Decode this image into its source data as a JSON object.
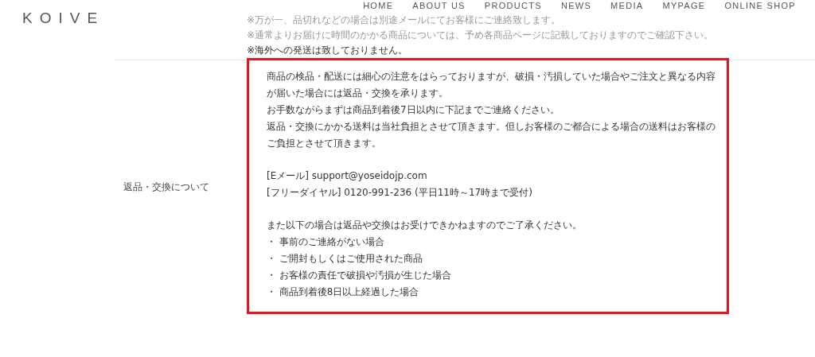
{
  "logo": "KOIVE",
  "nav": [
    "HOME",
    "ABOUT US",
    "PRODUCTS",
    "NEWS",
    "MEDIA",
    "MYPAGE",
    "ONLINE SHOP"
  ],
  "notes": [
    {
      "text": "※万が一、品切れなどの場合は別途メールにてお客様にご連絡致します。",
      "muted": true
    },
    {
      "text": "※通常よりお届けに時間のかかる商品については、予め各商品ページに記載しておりますのでご確認下さい。",
      "muted": true
    },
    {
      "text": "※海外への発送は致しておりません。",
      "muted": false
    }
  ],
  "row": {
    "label": "返品・交換について",
    "highlighted": true,
    "blocks": [
      [
        "商品の検品・配送には細心の注意をはらっておりますが、破損・汚損していた場合やご注文と異なる内容が届いた場合には返品・交換を承ります。",
        "お手数ながらまずは商品到着後7日以内に下記までご連絡ください。",
        "返品・交換にかかる送料は当社負担とさせて頂きます。但しお客様のご都合による場合の送料はお客様のご負担とさせて頂きます。"
      ],
      [
        "[Eメール] support@yoseidojp.com",
        "[フリーダイヤル] 0120-991-236 (平日11時～17時まで受付)"
      ],
      [
        "また以下の場合は返品や交換はお受けできかねますのでご了承ください。",
        "・ 事前のご連絡がない場合",
        "・ ご開封もしくはご使用された商品",
        "・ お客様の責任で破損や汚損が生じた場合",
        "・ 商品到着後8日以上経過した場合"
      ]
    ]
  }
}
